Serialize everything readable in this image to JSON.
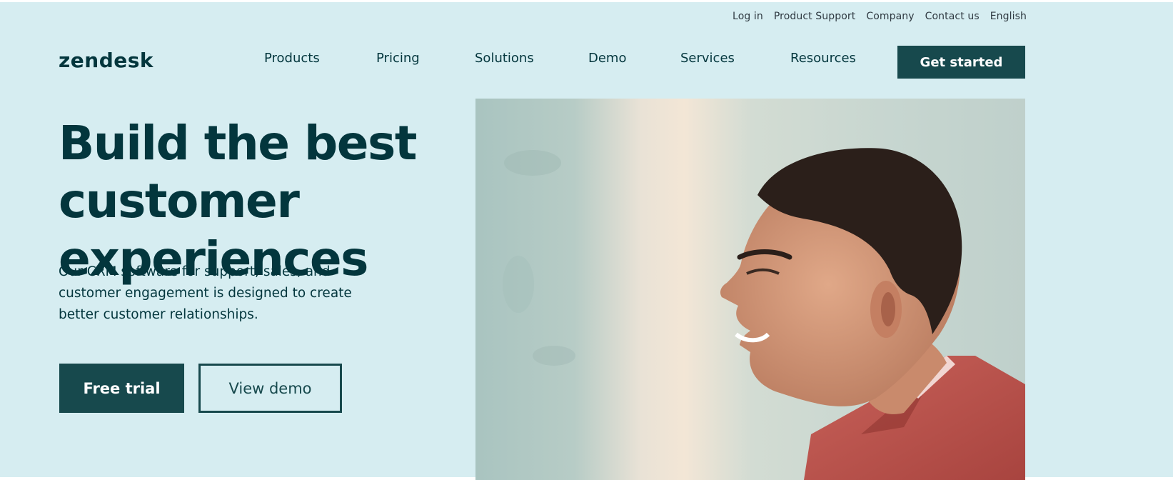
{
  "utility_nav": {
    "login": "Log in",
    "product_support": "Product Support",
    "company": "Company",
    "contact": "Contact us",
    "language": "English"
  },
  "brand": {
    "logo_text": "zendesk"
  },
  "main_nav": {
    "items": [
      "Products",
      "Pricing",
      "Solutions",
      "Demo",
      "Services",
      "Resources"
    ],
    "cta": "Get started"
  },
  "hero": {
    "headline_line1": "Build the best customer",
    "headline_line2": "experiences",
    "subcopy_line1": "Our CRM software for support, sales, and",
    "subcopy_line2": "customer engagement is designed to create",
    "subcopy_line3": "better customer relationships.",
    "primary_cta": "Free trial",
    "secondary_cta": "View demo",
    "image_subject": "smiling-man-profile"
  },
  "colors": {
    "background": "#d6edf1",
    "brand_dark": "#03363d",
    "button": "#17494d",
    "shirt": "#c0574f"
  }
}
